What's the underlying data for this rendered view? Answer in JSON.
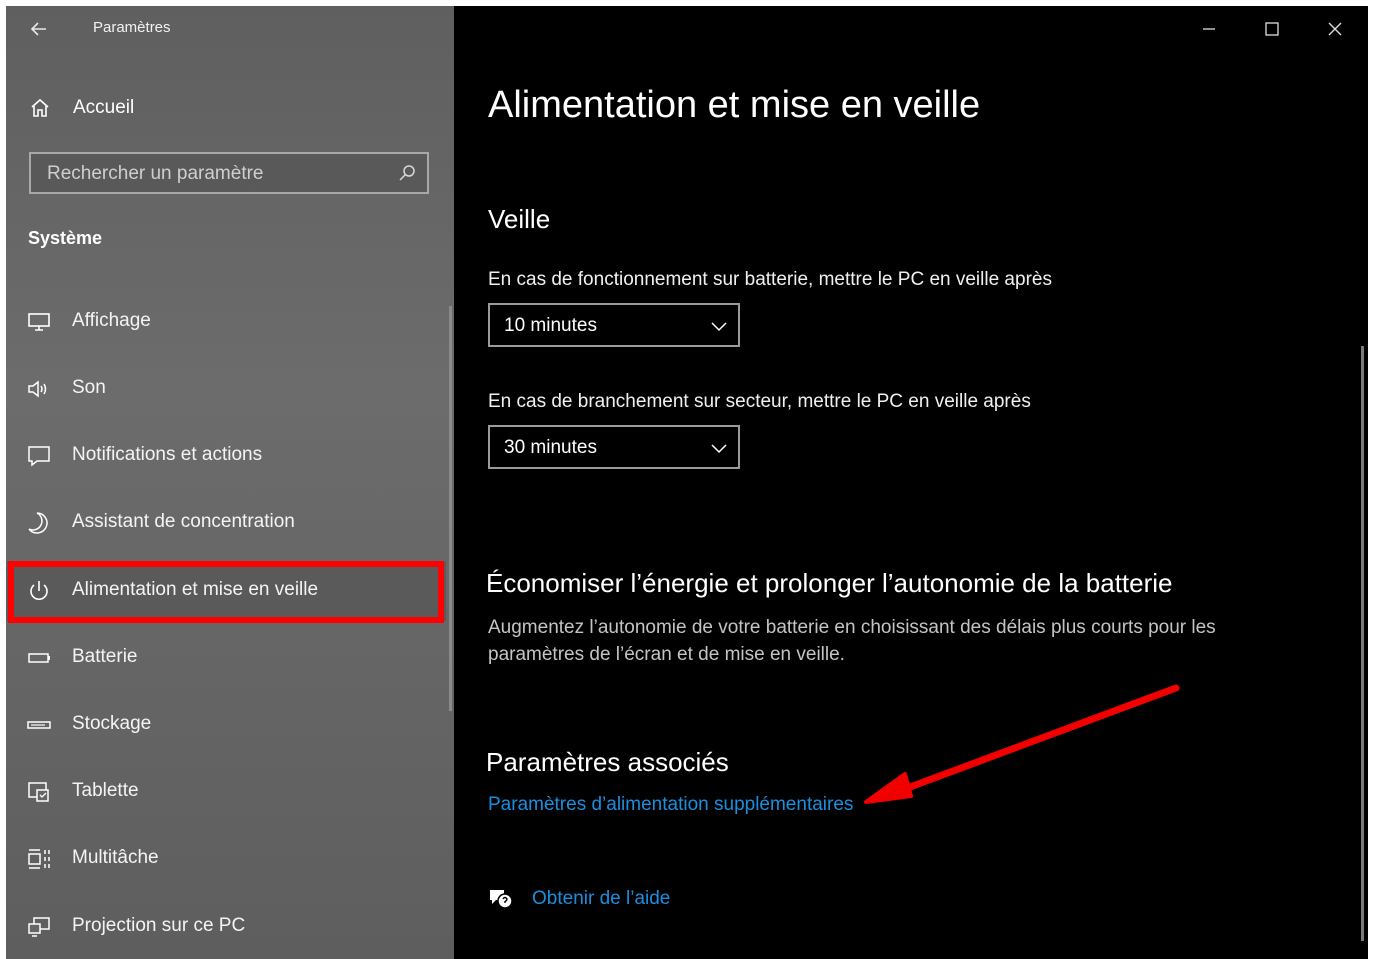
{
  "window": {
    "app_title": "Paramètres",
    "controls": [
      "minimize",
      "maximize",
      "close"
    ]
  },
  "sidebar": {
    "home_label": "Accueil",
    "search": {
      "placeholder": "Rechercher un paramètre",
      "value": ""
    },
    "section_title": "Système",
    "items": [
      {
        "label": "Affichage",
        "icon": "monitor-icon"
      },
      {
        "label": "Son",
        "icon": "speaker-icon"
      },
      {
        "label": "Notifications et actions",
        "icon": "notification-icon"
      },
      {
        "label": "Assistant de concentration",
        "icon": "moon-icon"
      },
      {
        "label": "Alimentation et mise en veille",
        "icon": "power-icon",
        "selected": true
      },
      {
        "label": "Batterie",
        "icon": "battery-icon"
      },
      {
        "label": "Stockage",
        "icon": "storage-icon"
      },
      {
        "label": "Tablette",
        "icon": "tablet-icon"
      },
      {
        "label": "Multitâche",
        "icon": "multitask-icon"
      },
      {
        "label": "Projection sur ce PC",
        "icon": "projection-icon"
      }
    ]
  },
  "main": {
    "title": "Alimentation et mise en veille",
    "sleep": {
      "heading": "Veille",
      "battery_label": "En cas de fonctionnement sur batterie, mettre le PC en veille après",
      "battery_value": "10 minutes",
      "plugged_label": "En cas de branchement sur secteur, mettre le PC en veille après",
      "plugged_value": "30 minutes"
    },
    "save_energy": {
      "heading": "Économiser l’énergie et prolonger l’autonomie de la batterie",
      "description": "Augmentez l’autonomie de votre batterie en choisissant des délais plus courts pour les paramètres de l’écran et de mise en veille."
    },
    "related": {
      "heading": "Paramètres associés",
      "link": "Paramètres d’alimentation supplémentaires"
    },
    "help_link": "Obtenir de l’aide"
  },
  "colors": {
    "accent_link": "#1a8fe0",
    "annotation": "#ff0000",
    "content_bg": "#000000"
  }
}
